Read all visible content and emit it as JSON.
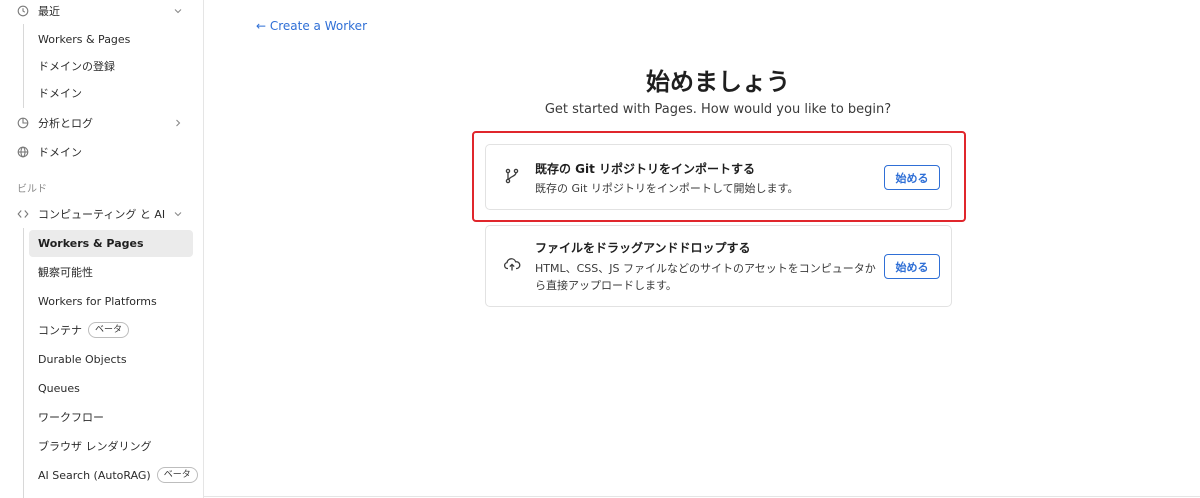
{
  "sidebar": {
    "recent": {
      "label": "最近"
    },
    "recent_items": [
      "Workers & Pages",
      "ドメインの登録",
      "ドメイン"
    ],
    "analytics": {
      "label": "分析とログ"
    },
    "domains": {
      "label": "ドメイン"
    },
    "build_section": "ビルド",
    "compute": {
      "label": "コンピューティング と AI"
    },
    "compute_items": [
      {
        "label": "Workers & Pages",
        "active": true
      },
      {
        "label": "観察可能性"
      },
      {
        "label": "Workers for Platforms"
      },
      {
        "label": "コンテナ",
        "badge": "ベータ"
      },
      {
        "label": "Durable Objects"
      },
      {
        "label": "Queues"
      },
      {
        "label": "ワークフロー"
      },
      {
        "label": "ブラウザ レンダリング"
      },
      {
        "label": "AI Search (AutoRAG)",
        "badge": "ベータ"
      }
    ]
  },
  "main": {
    "back_link": "← Create a Worker",
    "title": "始めましょう",
    "subtitle": "Get started with Pages. How would you like to begin?",
    "cards": [
      {
        "title": "既存の Git リポジトリをインポートする",
        "description": "既存の Git リポジトリをインポートして開始します。",
        "button": "始める",
        "icon": "git-branch-icon",
        "highlighted": true
      },
      {
        "title": "ファイルをドラッグアンドドロップする",
        "description": "HTML、CSS、JS ファイルなどのサイトのアセットをコンピュータから直接アップロードします。",
        "button": "始める",
        "icon": "cloud-upload-icon"
      }
    ]
  },
  "colors": {
    "accent": "#2f6fd6",
    "highlight": "#e0262c",
    "active_bg": "#ebebeb"
  }
}
